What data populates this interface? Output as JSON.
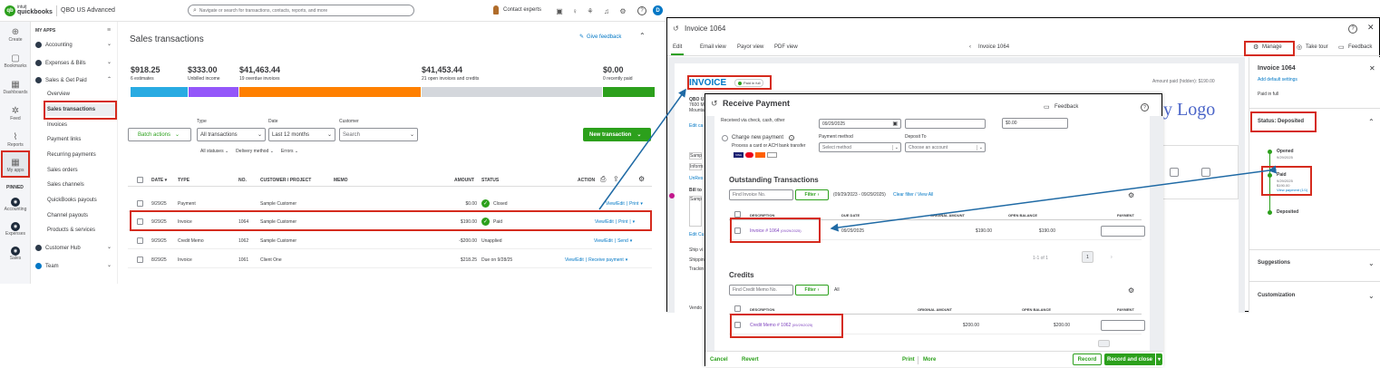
{
  "topbar": {
    "brand_line1": "intuit",
    "brand_line2": "quickbooks",
    "company": "QBO US Advanced",
    "search_placeholder": "Navigate or search for transactions, contacts, reports, and more",
    "contact": "Contact experts"
  },
  "rail": [
    {
      "label": "Create",
      "icon": "⊕"
    },
    {
      "label": "Bookmarks",
      "icon": "▢"
    },
    {
      "label": "Dashboards",
      "icon": "▦"
    },
    {
      "label": "Feed",
      "icon": "✲"
    },
    {
      "label": "Reports",
      "icon": "⌇"
    },
    {
      "label": "My apps",
      "icon": "▦"
    },
    {
      "label": "PINNED",
      "icon": ""
    },
    {
      "label": "Accounting",
      "icon": "●"
    },
    {
      "label": "Expenses",
      "icon": "●"
    },
    {
      "label": "Sales",
      "icon": "●"
    }
  ],
  "nav": {
    "myapps": "MY APPS",
    "accounting": "Accounting",
    "expenses": "Expenses & Bills",
    "sales": "Sales & Get Paid",
    "items": [
      "Overview",
      "Sales transactions",
      "Invoices",
      "Payment links",
      "Recurring payments",
      "Sales orders",
      "Sales channels",
      "QuickBooks payouts",
      "Channel payouts",
      "Products & services"
    ],
    "customer_hub": "Customer Hub",
    "team": "Team"
  },
  "main": {
    "title": "Sales transactions",
    "feedback": "Give feedback",
    "stats": [
      {
        "amount": "$918.25",
        "label": "6 estimates",
        "color": "#29abe2"
      },
      {
        "amount": "$333.00",
        "label": "Unbilled income",
        "color": "#9457fa"
      },
      {
        "amount": "$41,463.44",
        "label": "19 overdue invoices",
        "color": "#ff8000"
      },
      {
        "amount": "$41,453.44",
        "label": "21 open invoices and credits",
        "color": "#d4d7dc"
      },
      {
        "amount": "$0.00",
        "label": "0 recently paid",
        "color": "#2ca01c"
      }
    ],
    "filters": {
      "type_label": "Type",
      "type_value": "All transactions",
      "date_label": "Date",
      "date_value": "Last 12 months",
      "customer_label": "Customer",
      "customer_placeholder": "Search",
      "batch": "Batch actions",
      "new_txn": "New transaction",
      "statuses": "All statuses",
      "delivery": "Delivery method",
      "errors": "Errors"
    },
    "columns": [
      "DATE",
      "TYPE",
      "NO.",
      "CUSTOMER / PROJECT",
      "MEMO",
      "AMOUNT",
      "STATUS",
      "ACTION"
    ],
    "rows": [
      {
        "date": "9/29/25",
        "type": "Payment",
        "no": "",
        "customer": "Sample Customer",
        "amount": "$0.00",
        "status": "Closed",
        "action1": "View/Edit",
        "action2": "Print"
      },
      {
        "date": "9/29/25",
        "type": "Invoice",
        "no": "1064",
        "customer": "Sample Customer",
        "amount": "$190.00",
        "status": "Paid",
        "action1": "View/Edit",
        "action2": "Print"
      },
      {
        "date": "9/29/25",
        "type": "Credit Memo",
        "no": "1062",
        "customer": "Sample Customer",
        "amount": "-$200.00",
        "status": "Unapplied",
        "action1": "View/Edit",
        "action2": "Send"
      },
      {
        "date": "8/29/25",
        "type": "Invoice",
        "no": "1061",
        "customer": "Client One",
        "amount": "$218.25",
        "status": "Due on 9/28/25",
        "action1": "View/Edit",
        "action2": "Receive payment"
      }
    ]
  },
  "invoice": {
    "title": "Invoice 1064",
    "tabs": [
      "Edit",
      "Email view",
      "Payor view",
      "PDF view"
    ],
    "nav_center": "Invoice 1064",
    "manage": "Manage",
    "tour": "Take tour",
    "feedback": "Feedback",
    "doc_title": "INVOICE",
    "paid_badge": "Paid in full",
    "amount_paid": "Amount paid (hidden): $190.00",
    "logo_text": "y Logo",
    "left_fragments": [
      "QBO U",
      "7600 M",
      "Mounta",
      "Edit ca",
      "Samp",
      "Inform",
      "UnRes",
      "Bill to",
      "Samp",
      "Edit Cu",
      "Ship vi",
      "Shippin",
      "Trackin",
      "Vendo"
    ],
    "side": {
      "title": "Invoice 1064",
      "add_settings": "Add default settings",
      "paid_in_full": "Paid in full",
      "status": "Status: Deposited",
      "timeline": [
        {
          "label": "Opened",
          "sub": "9/29/2025"
        },
        {
          "label": "Paid",
          "sub": "9/29/2025",
          "sub2": "$190.00",
          "link": "View payment (1/1)"
        },
        {
          "label": "Deposited",
          "sub": ""
        }
      ],
      "suggestions": "Suggestions",
      "customization": "Customization"
    }
  },
  "receive": {
    "title": "Receive Payment",
    "feedback": "Feedback",
    "received_via": "Received via check, cash, other",
    "date": "09/29/2025",
    "amount": "$0.00",
    "charge_new": "Charge new payment",
    "charge_sub": "Process a card or ACH bank transfer",
    "payment_method_label": "Payment method",
    "payment_method_placeholder": "Select method",
    "deposit_label": "Deposit To",
    "deposit_placeholder": "Choose an account",
    "outstanding_title": "Outstanding Transactions",
    "find_invoice_placeholder": "Find Invoice No.",
    "filter": "Filter",
    "date_range": "(09/29/2023 - 09/29/2025)",
    "clear_filter": "Clear filter / View All",
    "out_columns": [
      "DESCRIPTION",
      "DUE DATE",
      "ORIGINAL AMOUNT",
      "OPEN BALANCE",
      "PAYMENT"
    ],
    "out_row": {
      "desc": "Invoice # 1064",
      "desc_date": "(09/29/2025)",
      "due": "09/29/2025",
      "original": "$190.00",
      "open": "$190.00"
    },
    "pager": "1-1 of 1",
    "page": "1",
    "credits_title": "Credits",
    "find_credit_placeholder": "Find Credit Memo No.",
    "all": "All",
    "cred_columns": [
      "DESCRIPTION",
      "ORIGINAL AMOUNT",
      "OPEN BALANCE",
      "PAYMENT"
    ],
    "cred_row": {
      "desc": "Credit Memo # 1062",
      "desc_date": "(09/29/2025)",
      "original": "$200.00",
      "open": "$200.00"
    },
    "footer": {
      "cancel": "Cancel",
      "revert": "Revert",
      "print": "Print",
      "more": "More",
      "record": "Record",
      "record_close": "Record and close"
    }
  },
  "colors": {
    "green": "#2ca01c",
    "blue": "#0077c5",
    "red": "#d52b1e",
    "arrow": "#1f6aa5"
  }
}
